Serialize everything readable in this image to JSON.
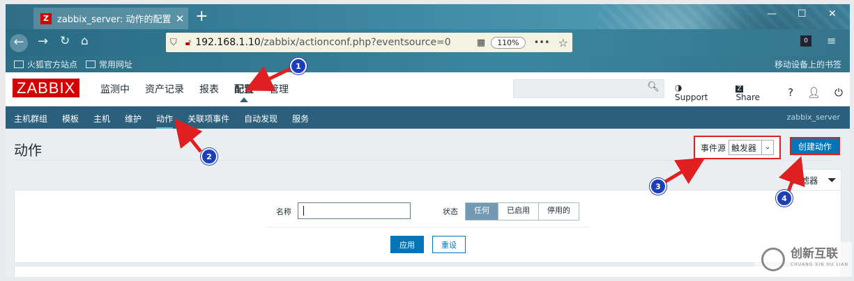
{
  "browser": {
    "tab_title": "zabbix_server: 动作的配置",
    "favicon_letter": "Z",
    "url_host": "192.168.1.10",
    "url_path": "/zabbix/actionconf.php?eventsource=0",
    "zoom": "110%",
    "bookmarks": [
      "火狐官方站点",
      "常用网址"
    ],
    "mobile_bookmarks": "移动设备上的书签",
    "ext_badge": "0"
  },
  "header": {
    "logo": "ZABBIX",
    "menu": [
      "监测中",
      "资产记录",
      "报表",
      "配置",
      "管理"
    ],
    "support": "Support",
    "share": "Share",
    "share_icon": "Z",
    "help": "?"
  },
  "submenu": {
    "items": [
      "主机群组",
      "模板",
      "主机",
      "维护",
      "动作",
      "关联项事件",
      "自动发现",
      "服务"
    ],
    "server": "zabbix_server"
  },
  "page": {
    "title": "动作",
    "event_source_label": "事件源",
    "event_source_value": "触发器",
    "create_button": "创建动作",
    "filter_tab": "过滤器",
    "filter": {
      "name_label": "名称",
      "name_value": "",
      "status_label": "状态",
      "status_options": [
        "任何",
        "已启用",
        "停用的"
      ],
      "apply": "应用",
      "reset": "重设"
    }
  },
  "annotations": [
    "1",
    "2",
    "3",
    "4"
  ],
  "watermark": {
    "text": "创新互联",
    "sub": "CHUANG XIN HU LIAN"
  },
  "colors": {
    "zabbix_red": "#d40000",
    "nav_blue": "#2c5f7b",
    "button_blue": "#0275b8",
    "highlight_red": "#e02020",
    "badge_blue": "#1c3fb8"
  }
}
